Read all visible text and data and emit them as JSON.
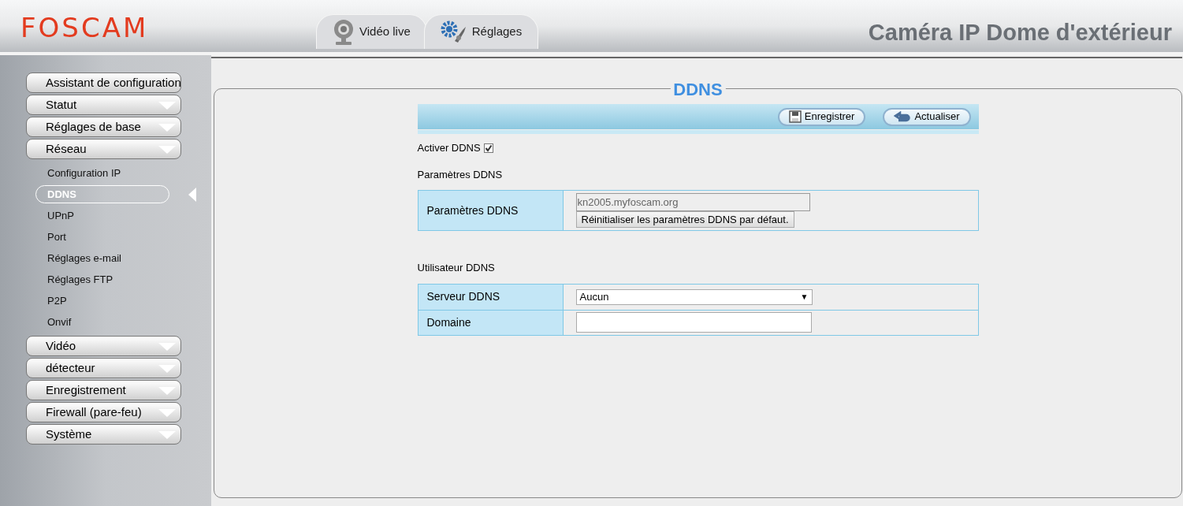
{
  "header": {
    "logo": "FOSCAM",
    "title": "Caméra IP Dome d'extérieur",
    "tabs": [
      {
        "label": "Vidéo live",
        "kind": "webcam"
      },
      {
        "label": "Réglages",
        "kind": "gears"
      }
    ]
  },
  "sidebar": {
    "items": [
      {
        "label": "Assistant de configuration",
        "kind": "link"
      },
      {
        "label": "Statut",
        "kind": "group"
      },
      {
        "label": "Réglages de base",
        "kind": "group"
      },
      {
        "label": "Réseau",
        "kind": "group",
        "children": [
          {
            "label": "Configuration IP",
            "selected": false
          },
          {
            "label": "DDNS",
            "selected": true
          },
          {
            "label": "UPnP",
            "selected": false
          },
          {
            "label": "Port",
            "selected": false
          },
          {
            "label": "Réglages e-mail",
            "selected": false
          },
          {
            "label": "Réglages FTP",
            "selected": false
          },
          {
            "label": "P2P",
            "selected": false
          },
          {
            "label": "Onvif",
            "selected": false
          }
        ]
      },
      {
        "label": "Vidéo",
        "kind": "group"
      },
      {
        "label": "détecteur",
        "kind": "group"
      },
      {
        "label": "Enregistrement",
        "kind": "group"
      },
      {
        "label": "Firewall (pare-feu)",
        "kind": "group"
      },
      {
        "label": "Système",
        "kind": "group"
      }
    ]
  },
  "panel": {
    "title": "DDNS",
    "toolbar": [
      {
        "label": "Enregistrer",
        "kind": "save"
      },
      {
        "label": "Actualiser",
        "kind": "undo"
      }
    ],
    "enable": {
      "label": "Activer DDNS",
      "checked": true
    },
    "sections": [
      {
        "heading": "Paramètres DDNS",
        "rows": [
          {
            "label": "Paramètres DDNS",
            "kind": "readonly",
            "value": "kn2005.myfoscam.org",
            "button": "Réinitialiser les paramètres DDNS par défaut."
          }
        ]
      },
      {
        "heading": "Utilisateur DDNS",
        "rows": [
          {
            "label": "Serveur DDNS",
            "kind": "select",
            "value": "Aucun",
            "arrow": "▼"
          },
          {
            "label": "Domaine",
            "kind": "text"
          }
        ]
      }
    ]
  }
}
